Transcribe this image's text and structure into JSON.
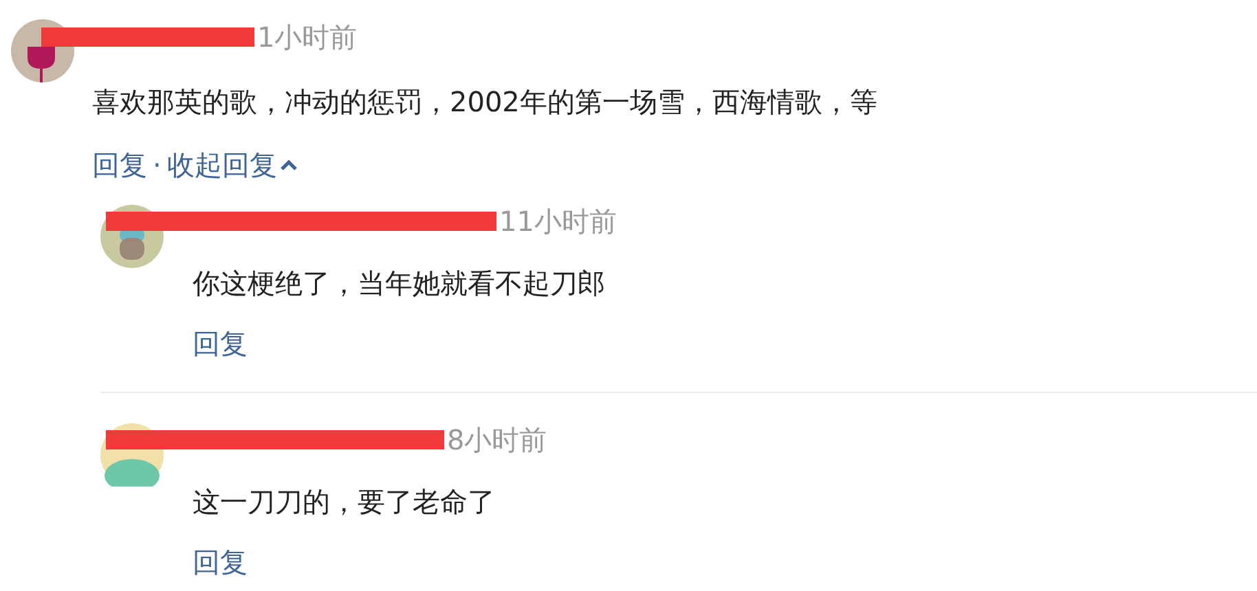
{
  "comment": {
    "time": "1小时前",
    "text": "喜欢那英的歌，冲动的惩罚，2002年的第一场雪，西海情歌，等",
    "actions": [
      {
        "label": "回复"
      },
      {
        "label": "·"
      },
      {
        "label": "收起回复",
        "expanded": true
      }
    ]
  },
  "replies": [
    {
      "time": "11小时前",
      "text": "你这梗绝了，当年她就看不起刀郎",
      "reply": "回复"
    },
    {
      "time": "8小时前",
      "text": "这一刀刀的，要了老命了",
      "reply": "回复"
    }
  ]
}
